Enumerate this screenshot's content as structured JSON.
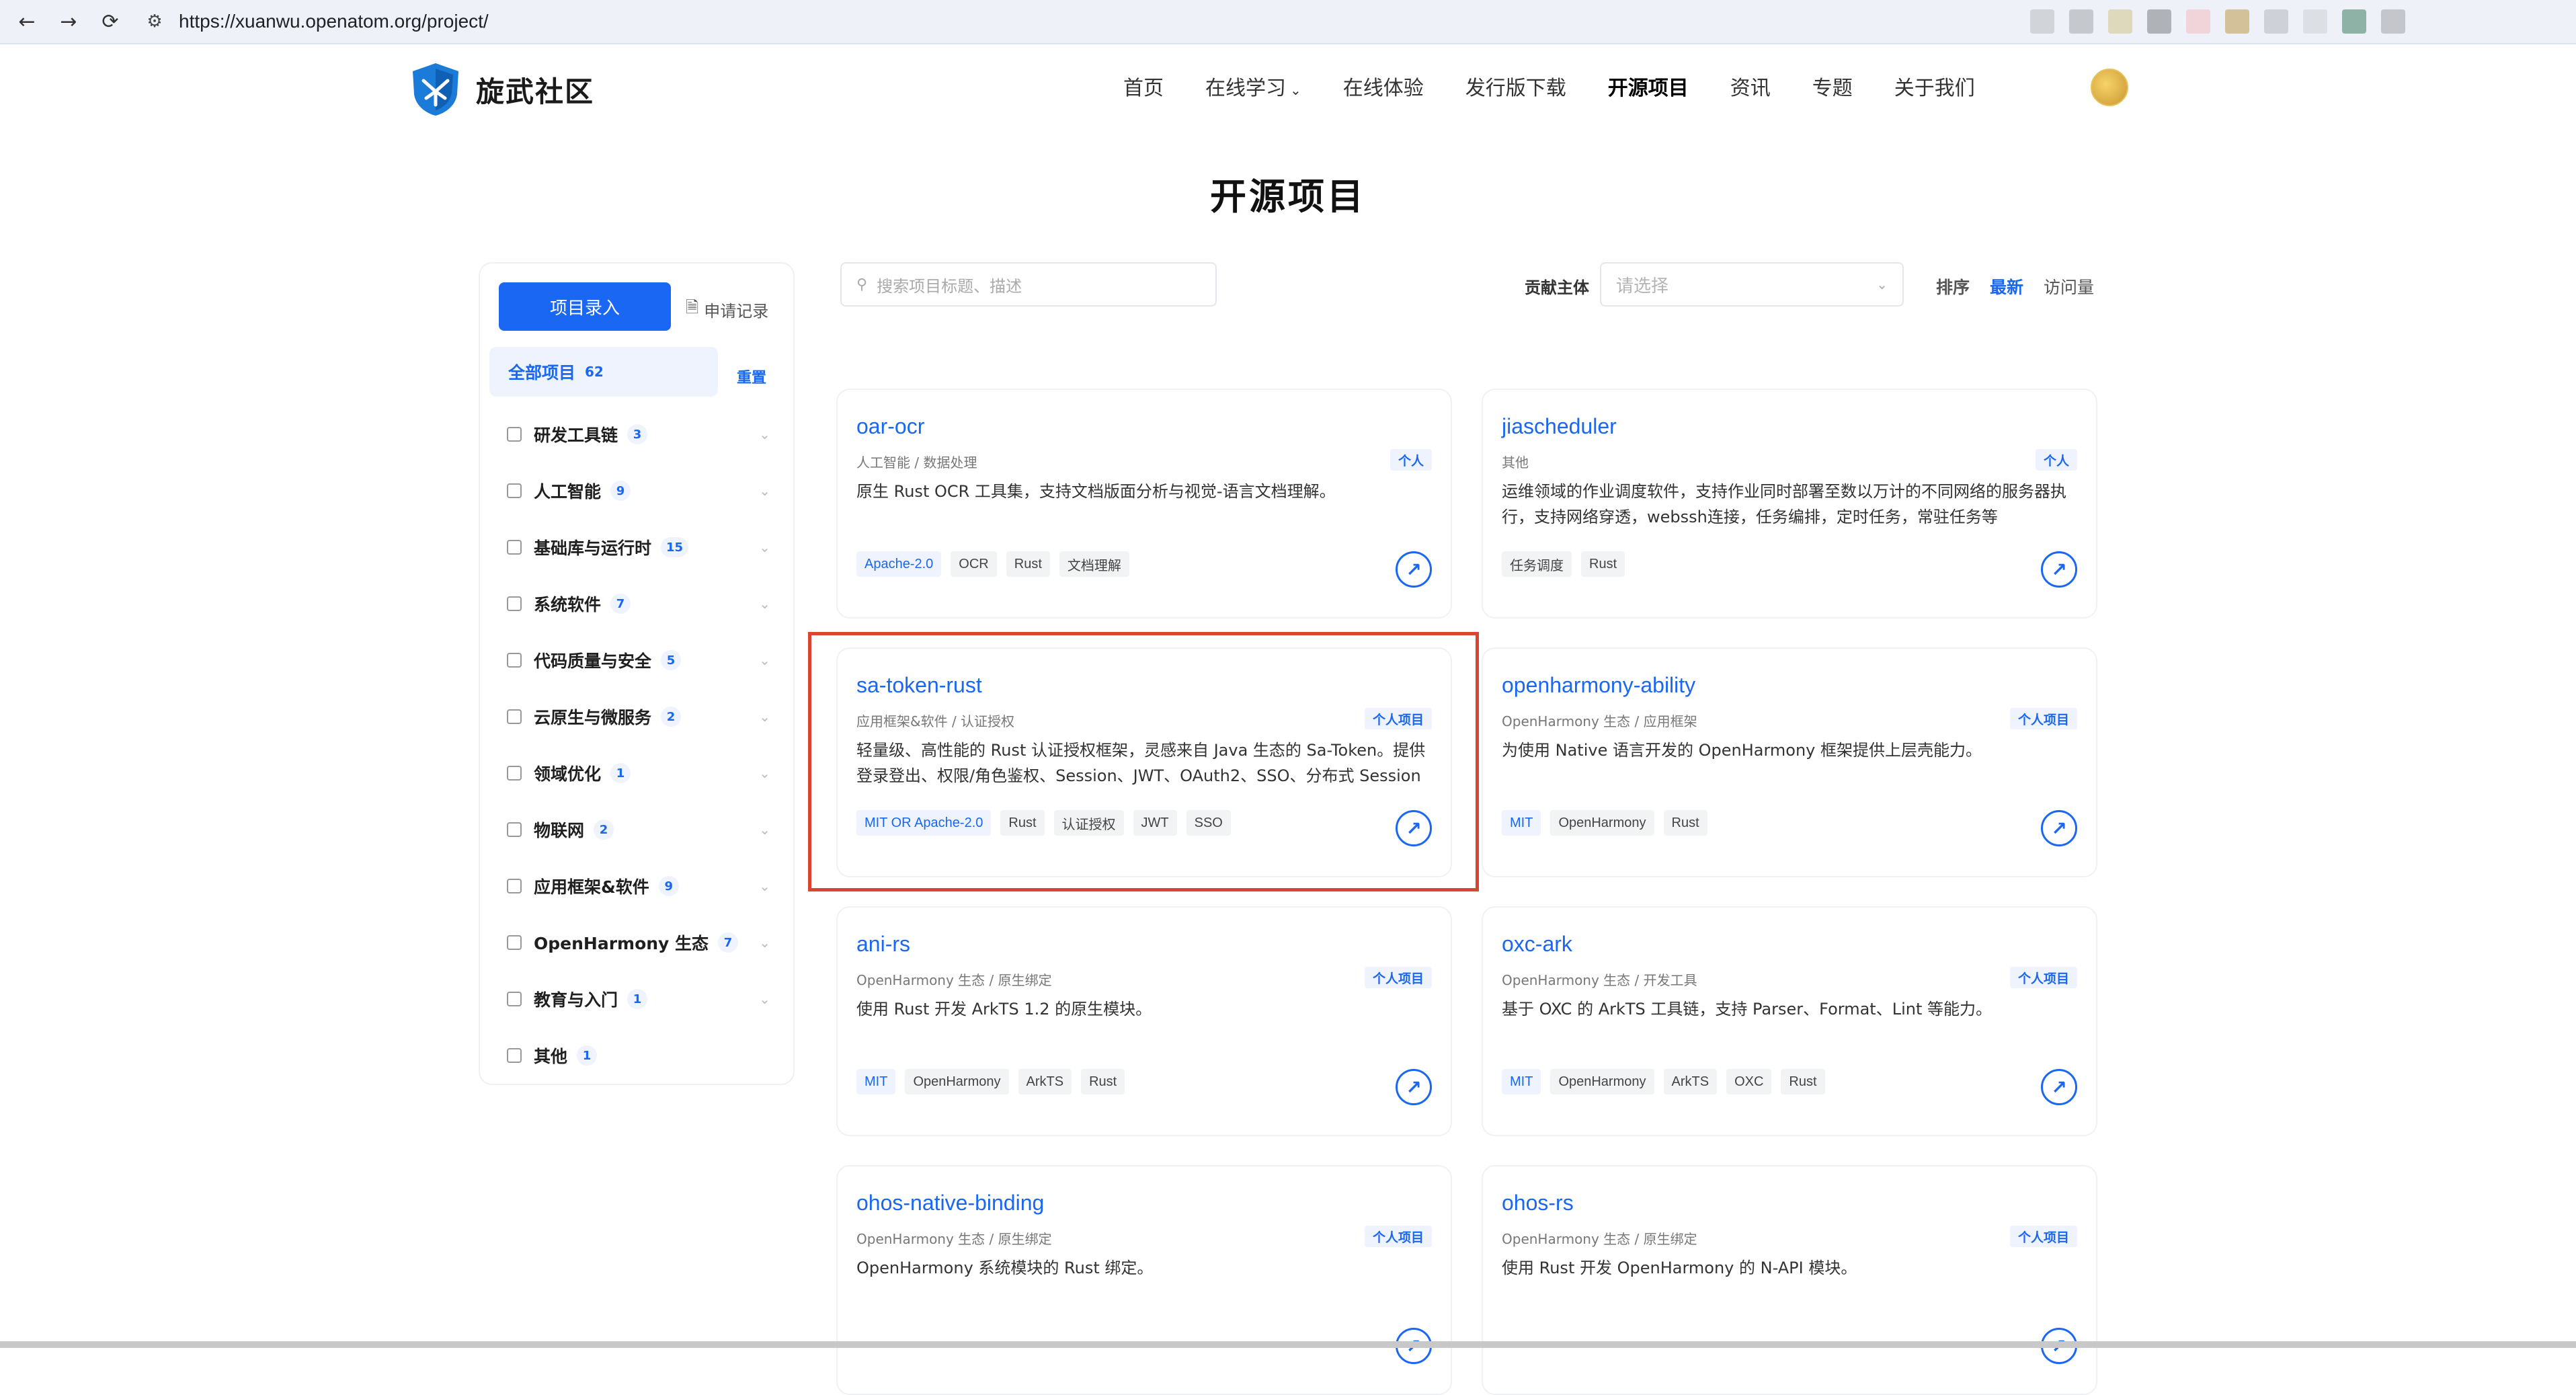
{
  "browser": {
    "back_icon": "←",
    "forward_icon": "→",
    "reload_icon": "⟳",
    "url": "https://xuanwu.openatom.org/project/"
  },
  "header": {
    "logo_text": "旋武社区",
    "nav": [
      {
        "label": "首页"
      },
      {
        "label": "在线学习"
      },
      {
        "label": "在线体验"
      },
      {
        "label": "发行版下载"
      },
      {
        "label": "开源项目"
      },
      {
        "label": "资讯"
      },
      {
        "label": "专题"
      },
      {
        "label": "关于我们"
      }
    ]
  },
  "page_title": "开源项目",
  "sidebar": {
    "submit_button": "项目录入",
    "apply_records": "申请记录",
    "all_label": "全部项目",
    "all_count": "62",
    "reset": "重置",
    "categories": [
      {
        "label": "研发工具链",
        "count": "3"
      },
      {
        "label": "人工智能",
        "count": "9"
      },
      {
        "label": "基础库与运行时",
        "count": "15"
      },
      {
        "label": "系统软件",
        "count": "7"
      },
      {
        "label": "代码质量与安全",
        "count": "5"
      },
      {
        "label": "云原生与微服务",
        "count": "2"
      },
      {
        "label": "领域优化",
        "count": "1"
      },
      {
        "label": "物联网",
        "count": "2"
      },
      {
        "label": "应用框架&软件",
        "count": "9"
      },
      {
        "label": "OpenHarmony 生态",
        "count": "7"
      },
      {
        "label": "教育与入门",
        "count": "1"
      },
      {
        "label": "其他",
        "count": "1"
      }
    ]
  },
  "toolbar": {
    "search_placeholder": "搜索项目标题、描述",
    "contributor_label": "贡献主体",
    "contributor_placeholder": "请选择",
    "sort_label": "排序",
    "sort_latest": "最新",
    "sort_views": "访问量"
  },
  "cards": [
    {
      "name": "oar-ocr",
      "category": "人工智能 / 数据处理",
      "type": "个人",
      "desc": "原生 Rust OCR 工具集，支持文档版面分析与视觉-语言文档理解。",
      "license": "Apache-2.0",
      "tags": [
        "OCR",
        "Rust",
        "文档理解"
      ]
    },
    {
      "name": "jiascheduler",
      "category": "其他",
      "type": "个人",
      "desc": "运维领域的作业调度软件，支持作业同时部署至数以万计的不同网络的服务器执行，支持网络穿透，webssh连接，任务编排，定时任务，常驻任务等",
      "license": "",
      "tags": [
        "任务调度",
        "Rust"
      ]
    },
    {
      "name": "sa-token-rust",
      "category": "应用框架&软件 / 认证授权",
      "type": "个人项目",
      "desc": "轻量级、高性能的 Rust 认证授权框架，灵感来自 Java 生态的 Sa-Token。提供登录登出、权限/角色鉴权、Session、JWT、OAuth2、SSO、分布式 Session ...",
      "license": "MIT OR Apache-2.0",
      "tags": [
        "Rust",
        "认证授权",
        "JWT",
        "SSO"
      ]
    },
    {
      "name": "openharmony-ability",
      "category": "OpenHarmony 生态 / 应用框架",
      "type": "个人项目",
      "desc": "为使用 Native 语言开发的 OpenHarmony 框架提供上层壳能力。",
      "license": "MIT",
      "tags": [
        "OpenHarmony",
        "Rust"
      ]
    },
    {
      "name": "ani-rs",
      "category": "OpenHarmony 生态 / 原生绑定",
      "type": "个人项目",
      "desc": "使用 Rust 开发 ArkTS 1.2 的原生模块。",
      "license": "MIT",
      "tags": [
        "OpenHarmony",
        "ArkTS",
        "Rust"
      ]
    },
    {
      "name": "oxc-ark",
      "category": "OpenHarmony 生态 / 开发工具",
      "type": "个人项目",
      "desc": "基于 OXC 的 ArkTS 工具链，支持 Parser、Format、Lint 等能力。",
      "license": "MIT",
      "tags": [
        "OpenHarmony",
        "ArkTS",
        "OXC",
        "Rust"
      ]
    },
    {
      "name": "ohos-native-binding",
      "category": "OpenHarmony 生态 / 原生绑定",
      "type": "个人项目",
      "desc": "OpenHarmony 系统模块的 Rust 绑定。",
      "license": "",
      "tags": []
    },
    {
      "name": "ohos-rs",
      "category": "OpenHarmony 生态 / 原生绑定",
      "type": "个人项目",
      "desc": "使用 Rust 开发 OpenHarmony 的 N-API 模块。",
      "license": "",
      "tags": []
    }
  ],
  "colors": {
    "accent": "#1967f2",
    "highlight": "#d9452f"
  }
}
